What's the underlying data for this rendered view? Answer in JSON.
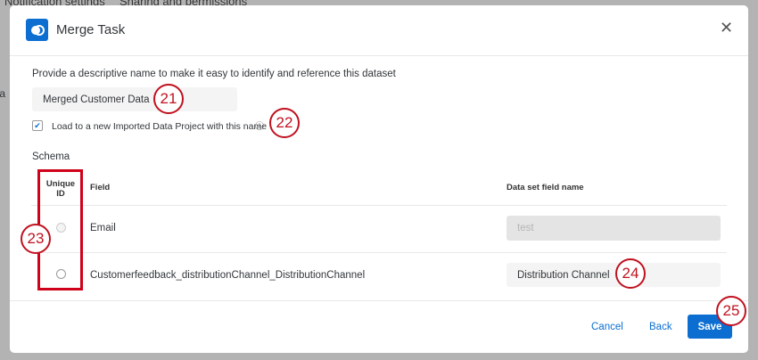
{
  "background": {
    "tabs": [
      "Notification settings",
      "Sharing and permissions"
    ],
    "side_text": "ta"
  },
  "dialog": {
    "title": "Merge Task",
    "name_label": "Provide a descriptive name to make it easy to identify and reference this dataset",
    "name_value": "Merged Customer Data",
    "load_checkbox_label": "Load to a new Imported Data Project with this name",
    "load_checked": true,
    "schema_label": "Schema",
    "columns": {
      "unique_id": "Unique ID",
      "field": "Field",
      "dataset_field_name": "Data set field name"
    },
    "rows": [
      {
        "field": "Email",
        "dataset_field_placeholder": "test",
        "dataset_field_value": "",
        "disabled": true
      },
      {
        "field": "Customerfeedback_distributionChannel_DistributionChannel",
        "dataset_field_value": "Distribution Channel",
        "disabled": false
      }
    ],
    "buttons": {
      "cancel": "Cancel",
      "back": "Back",
      "save": "Save"
    }
  },
  "callouts": [
    "21",
    "22",
    "23",
    "24",
    "25"
  ],
  "colors": {
    "accent": "#0b6ed0",
    "callout": "#c0111f"
  }
}
